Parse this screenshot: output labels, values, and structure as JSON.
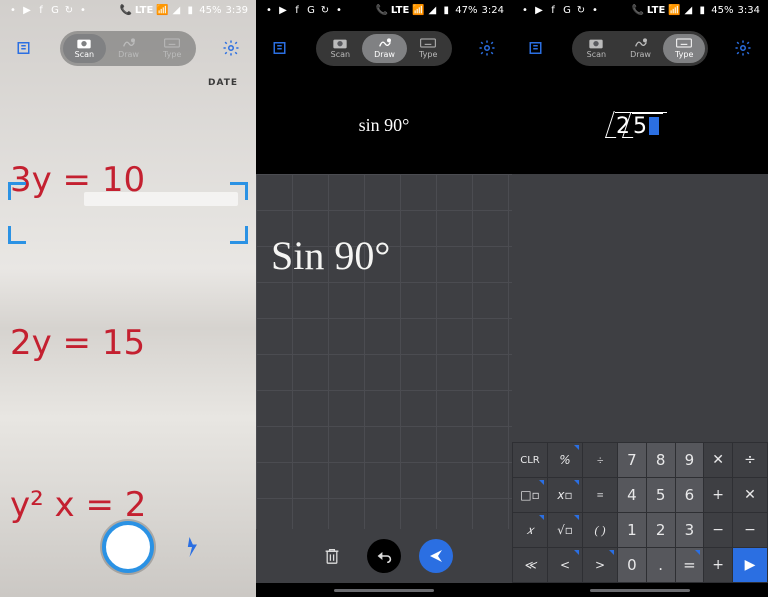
{
  "screens": [
    {
      "status": {
        "battery": "45%",
        "time": "3:39",
        "net": "LTE"
      },
      "modes": {
        "scan": "Scan",
        "draw": "Draw",
        "type": "Type",
        "active": "scan"
      },
      "date_label": "DATE",
      "equations": [
        "3y = 10",
        "2y = 15",
        "y² x = 2"
      ],
      "shutter": true
    },
    {
      "status": {
        "battery": "47%",
        "time": "3:24",
        "net": "LTE"
      },
      "modes": {
        "scan": "Scan",
        "draw": "Draw",
        "type": "Type",
        "active": "draw"
      },
      "formula": "sin 90°",
      "handwriting": "Sin 90°"
    },
    {
      "status": {
        "battery": "45%",
        "time": "3:34",
        "net": "LTE"
      },
      "modes": {
        "scan": "Scan",
        "draw": "Draw",
        "type": "Type",
        "active": "type"
      },
      "typed": {
        "outer": "2",
        "inner": "5"
      },
      "keypad": {
        "row1": [
          "CLR",
          "%",
          "÷",
          "7",
          "8",
          "9",
          "✕",
          "÷"
        ],
        "row2": [
          "□▫",
          "x▫",
          "≡",
          "4",
          "5",
          "6",
          "+",
          "✕"
        ],
        "row3": [
          "𝑥",
          "√▫",
          "(",
          ")",
          "1",
          "2",
          "3",
          "−",
          "−"
        ],
        "row4": [
          "≪",
          "<",
          ">",
          "0",
          ".",
          "=",
          "+",
          "▶"
        ]
      }
    }
  ]
}
